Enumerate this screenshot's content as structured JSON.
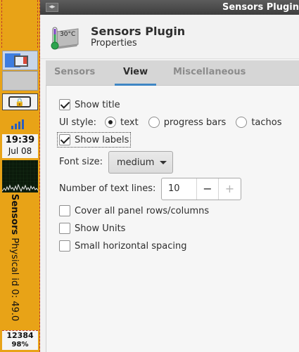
{
  "panel": {
    "clock_time": "19:39",
    "clock_date": "Jul 08",
    "sensor_label_bold": "Sensors",
    "sensor_reading": "Physical id 0: 49.0",
    "mem_value": "12384",
    "mem_percent": "98%",
    "lock_symbol": "🔒"
  },
  "window": {
    "title": "Sensors Plugin",
    "menu_glyph": "◂▸"
  },
  "header": {
    "title": "Sensors Plugin",
    "subtitle": "Properties",
    "icon_text": "30°C",
    "icon_name": "thermometer-icon"
  },
  "tabs": [
    {
      "label": "Sensors",
      "active": false
    },
    {
      "label": "View",
      "active": true
    },
    {
      "label": "Miscellaneous",
      "active": false
    }
  ],
  "view": {
    "show_title": {
      "label": "Show title",
      "checked": true
    },
    "ui_style": {
      "label": "UI style:",
      "options": [
        {
          "label": "text",
          "selected": true
        },
        {
          "label": "progress bars",
          "selected": false
        },
        {
          "label": "tachos",
          "selected": false
        }
      ]
    },
    "show_labels": {
      "label": "Show labels",
      "checked": true
    },
    "font_size": {
      "label": "Font size:",
      "value": "medium"
    },
    "text_lines": {
      "label": "Number of text lines:",
      "value": "10",
      "minus": "−",
      "plus": "+"
    },
    "cover_rows": {
      "label": "Cover all panel rows/columns",
      "checked": false
    },
    "show_units": {
      "label": "Show Units",
      "checked": false
    },
    "small_spacing": {
      "label": "Small horizontal spacing",
      "checked": false
    }
  },
  "colors": {
    "panel": "#e8a317",
    "accent": "#3f86c4",
    "titlebar": "#4a4a4a"
  }
}
